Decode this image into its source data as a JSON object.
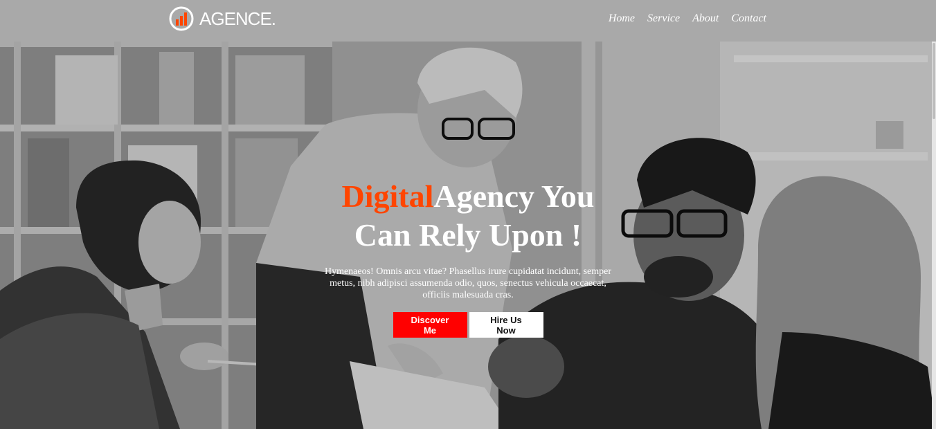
{
  "header": {
    "brand": "AGENCE.",
    "nav": [
      "Home",
      "Service",
      "About",
      "Contact"
    ]
  },
  "hero": {
    "headline_accent": "Digital",
    "headline_line1": "Agency You",
    "headline_line2": "Can Rely Upon !",
    "description": "Hymenaeos! Omnis arcu vitae? Phasellus irure cupidatat incidunt, semper metus, nibh adipisci assumenda odio, quos, senectus vehicula occaecat, officiis malesuada cras.",
    "primary_button": "Discover Me",
    "secondary_button": "Hire Us Now"
  },
  "colors": {
    "accent": "#ff4500",
    "primary_button": "#ff0000",
    "header_bg": "#a9a9a9"
  }
}
